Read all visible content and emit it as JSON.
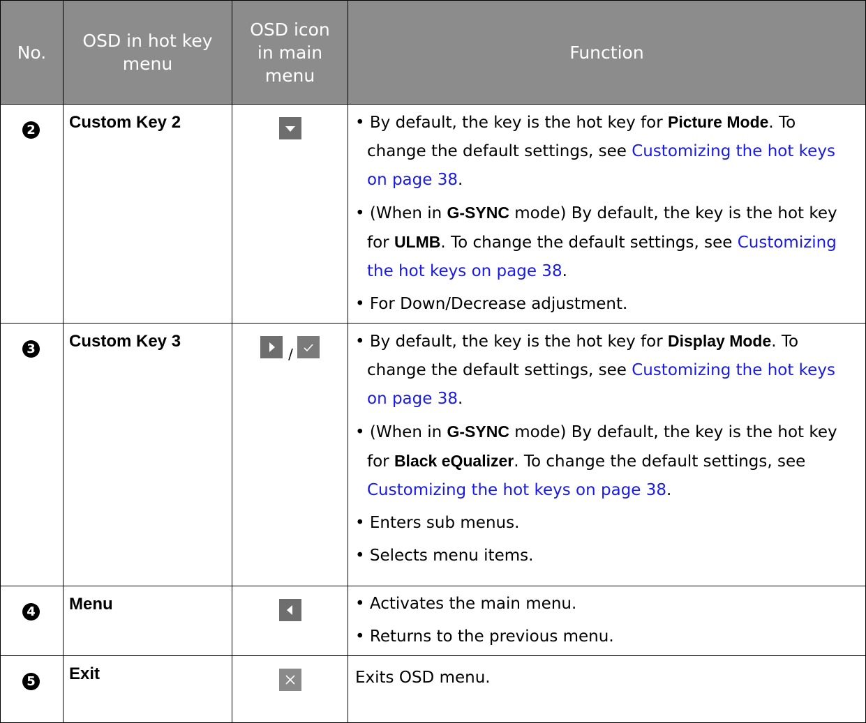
{
  "header": {
    "no": "No.",
    "osd_hotkey": "OSD in hot key menu",
    "osd_icon": "OSD icon in main menu",
    "function": "Function"
  },
  "rows": [
    {
      "num": "2",
      "name": "Custom Key 2",
      "icons": [
        "triangle-down-icon"
      ],
      "func": [
        {
          "t1": "By default, the key is the hot key for ",
          "b1": "Picture Mode",
          "t2": ". To change the default settings, see ",
          "link": "Customizing the hot keys on page 38",
          "t3": "."
        },
        {
          "t1": "(When in ",
          "b1": "G-SYNC",
          "t2": " mode) By default, the key is the hot key for ",
          "b2": "ULMB",
          "t3": ". To change the default settings, see ",
          "link": "Customizing the hot keys on page 38",
          "t4": "."
        },
        {
          "t1": "For Down/Decrease adjustment."
        }
      ]
    },
    {
      "num": "3",
      "name": "Custom Key 3",
      "icons": [
        "triangle-right-icon",
        "checkmark-icon"
      ],
      "separator": "/",
      "func": [
        {
          "t1": "By default, the key is the hot key for ",
          "b1": "Display Mode",
          "t2": ". To change the default settings, see ",
          "link": "Customizing the hot keys on page 38",
          "t3": "."
        },
        {
          "t1": "(When in ",
          "b1": "G-SYNC",
          "t2": " mode) By default, the key is the hot key for ",
          "b2": "Black eQualizer",
          "t3": ". To change the default settings, see ",
          "link": "Customizing the hot keys on page 38",
          "t4": "."
        },
        {
          "t1": "Enters sub menus."
        },
        {
          "t1": "Selects menu items."
        }
      ]
    },
    {
      "num": "4",
      "name": "Menu",
      "icons": [
        "triangle-left-icon"
      ],
      "func": [
        {
          "t1": "Activates the main menu."
        },
        {
          "t1": "Returns to the previous menu."
        }
      ]
    },
    {
      "num": "5",
      "name": "Exit",
      "icons": [
        "close-icon"
      ],
      "func_plain": "Exits OSD menu."
    }
  ],
  "bullet": "•",
  "colors": {
    "header_bg": "#8c8c8c",
    "header_text": "#ffffff",
    "icon_bg": "#6e6e6e",
    "link": "#1a1ae6"
  }
}
